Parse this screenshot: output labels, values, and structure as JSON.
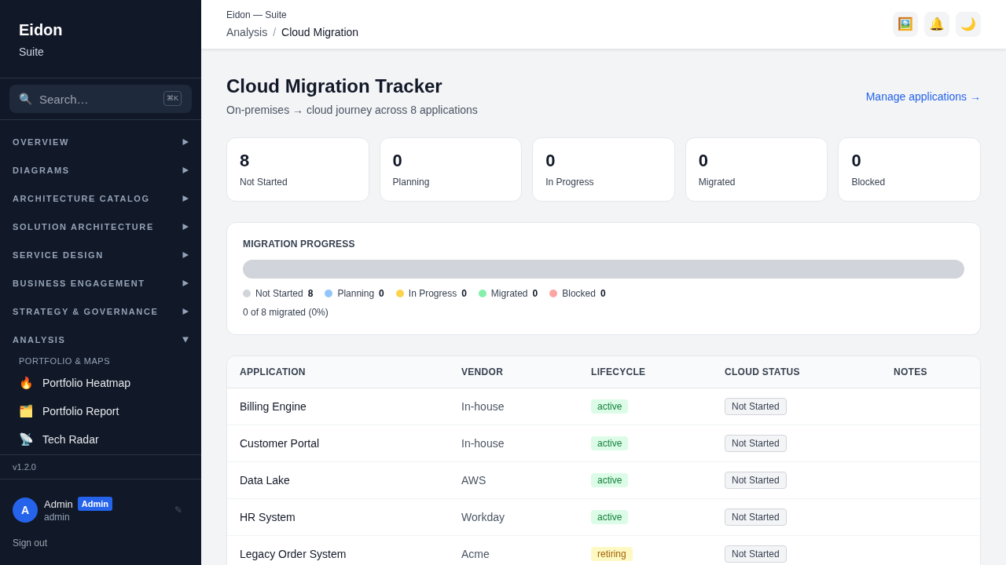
{
  "sidebar": {
    "brand": {
      "name": "Eidon",
      "subtitle": "Suite"
    },
    "search": {
      "icon": "🔍",
      "placeholder": "Search…",
      "shortcut": "⌘K"
    },
    "nav": [
      {
        "label": "OVERVIEW",
        "expanded": false
      },
      {
        "label": "DIAGRAMS",
        "expanded": false
      },
      {
        "label": "ARCHITECTURE CATALOG",
        "expanded": false
      },
      {
        "label": "SOLUTION ARCHITECTURE",
        "expanded": false
      },
      {
        "label": "SERVICE DESIGN",
        "expanded": false
      },
      {
        "label": "BUSINESS ENGAGEMENT",
        "expanded": false
      },
      {
        "label": "STRATEGY & GOVERNANCE",
        "expanded": false
      },
      {
        "label": "ANALYSIS",
        "expanded": true,
        "groups": [
          {
            "heading": "PORTFOLIO & MAPS",
            "items": [
              {
                "icon": "🔥",
                "label": "Portfolio Heatmap"
              },
              {
                "icon": "🗂️",
                "label": "Portfolio Report"
              },
              {
                "icon": "📡",
                "label": "Tech Radar"
              }
            ]
          }
        ]
      }
    ],
    "version": "v1.2.0",
    "user": {
      "initial": "A",
      "name": "Admin",
      "role": "Admin",
      "username": "admin",
      "edit_icon": "✎"
    },
    "sign_out": "Sign out"
  },
  "header": {
    "app": "Eidon — Suite",
    "breadcrumb": {
      "items": [
        "Analysis",
        "Cloud Migration"
      ],
      "separator": "/"
    },
    "actions": [
      {
        "icon": "🖼️"
      },
      {
        "icon": "🔔"
      },
      {
        "icon": "🌙"
      }
    ]
  },
  "page": {
    "title": "Cloud Migration Tracker",
    "subtitle": "On-premises → cloud journey across 8 applications",
    "link": "Manage applications →"
  },
  "stats": [
    {
      "value": "8",
      "label": "Not Started"
    },
    {
      "value": "0",
      "label": "Planning"
    },
    {
      "value": "0",
      "label": "In Progress"
    },
    {
      "value": "0",
      "label": "Migrated"
    },
    {
      "value": "0",
      "label": "Blocked"
    }
  ],
  "progress": {
    "title": "MIGRATION PROGRESS",
    "bar": [
      {
        "level": 1,
        "color": "#d1d5db"
      }
    ],
    "statuses": [
      {
        "label": "Not Started",
        "count": "8",
        "color": "#d1d5db"
      },
      {
        "label": "Planning",
        "count": "0",
        "color": "#93c5fd"
      },
      {
        "label": "In Progress",
        "count": "0",
        "color": "#fcd34d"
      },
      {
        "label": "Migrated",
        "count": "0",
        "color": "#86efac"
      },
      {
        "label": "Blocked",
        "count": "0",
        "color": "#fca5a5"
      }
    ],
    "summary": "0 of 8 migrated (0%)"
  },
  "table": {
    "columns": [
      "APPLICATION",
      "VENDOR",
      "LIFECYCLE",
      "CLOUD STATUS",
      "NOTES"
    ],
    "rows": [
      {
        "application": "Billing Engine",
        "vendor": "In-house",
        "lifecycle": {
          "label": "active",
          "kind": "ok"
        },
        "cloud_status": "Not Started"
      },
      {
        "application": "Customer Portal",
        "vendor": "In-house",
        "lifecycle": {
          "label": "active",
          "kind": "ok"
        },
        "cloud_status": "Not Started"
      },
      {
        "application": "Data Lake",
        "vendor": "AWS",
        "lifecycle": {
          "label": "active",
          "kind": "ok"
        },
        "cloud_status": "Not Started"
      },
      {
        "application": "HR System",
        "vendor": "Workday",
        "lifecycle": {
          "label": "active",
          "kind": "ok"
        },
        "cloud_status": "Not Started"
      },
      {
        "application": "Legacy Order System",
        "vendor": "Acme",
        "lifecycle": {
          "label": "retiring",
          "kind": "warn"
        },
        "cloud_status": "Not Started"
      }
    ]
  }
}
